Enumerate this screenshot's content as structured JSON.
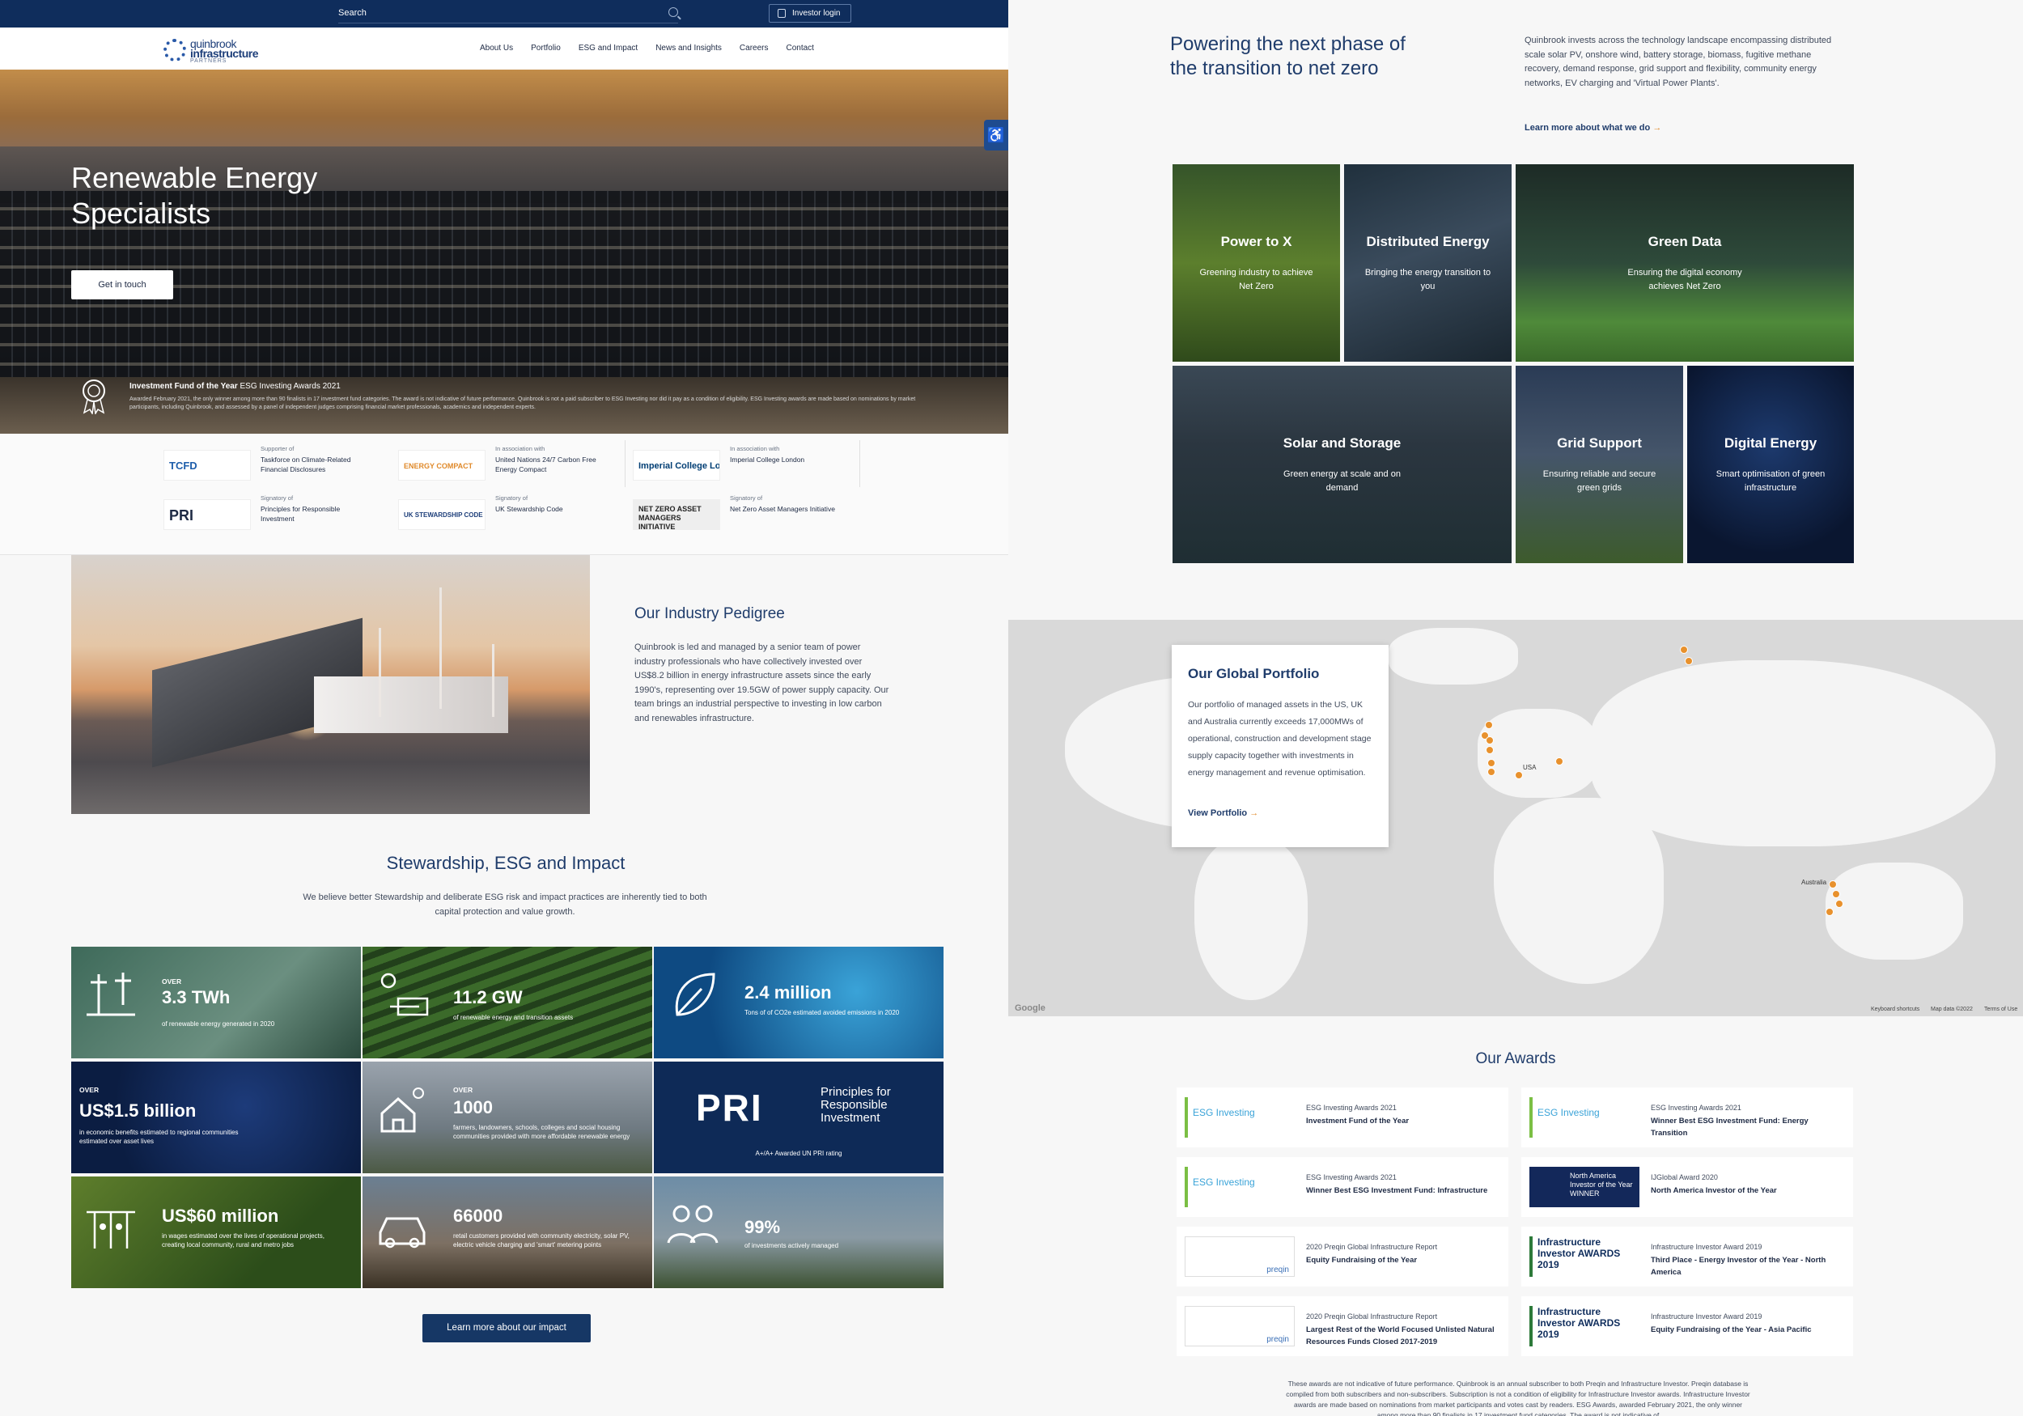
{
  "topbar": {
    "search_label": "Search",
    "investor_login": "Investor login"
  },
  "logo": {
    "line1": "quinbrook",
    "line2": "infrastructure",
    "line3": "PARTNERS"
  },
  "nav": [
    "About Us",
    "Portfolio",
    "ESG and Impact",
    "News and Insights",
    "Careers",
    "Contact"
  ],
  "hero": {
    "title": "Renewable Energy Specialists",
    "cta": "Get in touch",
    "award_title_bold": "Investment Fund of the Year",
    "award_title_rest": " ESG Investing Awards 2021",
    "award_desc": "Awarded February 2021, the only winner among more than 90 finalists in 17 investment fund categories. The award is not indicative of future performance. Quinbrook is not a paid subscriber to ESG Investing nor did it pay as a condition of eligibility. ESG Investing awards are made based on nominations by market participants, including Quinbrook, and assessed by a panel of independent judges comprising financial market professionals, academics and independent experts."
  },
  "supporters": [
    {
      "logo": "TCFD",
      "s1": "Supporter of",
      "s2": "Taskforce on Climate-Related Financial Disclosures"
    },
    {
      "logo": "ENERGY COMPACT",
      "s1": "In association with",
      "s2": "United Nations 24/7 Carbon Free Energy Compact"
    },
    {
      "logo": "Imperial College London",
      "s1": "In association with",
      "s2": "Imperial College London"
    },
    {
      "logo": "PRI",
      "s1": "Signatory of",
      "s2": "Principles for Responsible Investment"
    },
    {
      "logo": "UK STEWARDSHIP CODE 2021",
      "s1": "Signatory of",
      "s2": "UK Stewardship Code"
    },
    {
      "logo": "NET ZERO ASSET MANAGERS INITIATIVE",
      "s1": "Signatory of",
      "s2": "Net Zero Asset Managers Initiative"
    }
  ],
  "pedigree": {
    "title": "Our Industry Pedigree",
    "text": "Quinbrook is led and managed by a senior team of power industry professionals who have collectively invested over US$8.2 billion in energy infrastructure assets since the early 1990's, representing over 19.5GW of power supply capacity. Our team brings an industrial perspective to investing in low carbon and renewables infrastructure."
  },
  "stewardship": {
    "title": "Stewardship, ESG and Impact",
    "text": "We believe better Stewardship and deliberate ESG risk and impact practices are inherently tied to both capital protection and value growth.",
    "tiles": [
      {
        "over": "OVER",
        "big": "3.3 TWh",
        "sub": "of renewable energy generated in 2020"
      },
      {
        "over": "",
        "big": "11.2 GW",
        "sub": "of renewable energy and transition assets"
      },
      {
        "over": "",
        "big": "2.4 million",
        "sub": "Tons of of CO2e estimated avoided emissions in 2020"
      },
      {
        "over": "OVER",
        "big": "US$1.5 billion",
        "sub": "in economic benefits estimated to regional communities estimated over asset lives"
      },
      {
        "over": "OVER",
        "big": "1000",
        "sub": "farmers, landowners, schools, colleges and social housing communities provided with more affordable renewable energy"
      },
      {
        "over": "",
        "big": "PRI",
        "sub": "A+/A+ Awarded UN PRI rating"
      },
      {
        "over": "",
        "big": "US$60 million",
        "sub": "in wages estimated over the lives of operational projects, creating local community, rural and metro jobs"
      },
      {
        "over": "",
        "big": "66000",
        "sub": "retail customers provided with community electricity, solar PV, electric vehicle charging and 'smart' metering points"
      },
      {
        "over": "",
        "big": "99%",
        "sub": "of investments actively managed"
      }
    ],
    "pri_text": "Principles for Responsible Investment",
    "cta": "Learn more about our impact"
  },
  "powering": {
    "title": "Powering the next phase of the transition to net zero",
    "text": "Quinbrook invests across the technology landscape encompassing distributed scale solar PV, onshore wind, battery storage, biomass, fugitive methane recovery, demand response, grid support and flexibility, community energy networks, EV charging and 'Virtual Power Plants'.",
    "link": "Learn more about what we do",
    "arrow": "→"
  },
  "sectors": [
    {
      "title": "Power to X",
      "sub": "Greening industry to achieve Net Zero"
    },
    {
      "title": "Distributed Energy",
      "sub": "Bringing the energy transition to you"
    },
    {
      "title": "Green Data",
      "sub": "Ensuring the digital economy achieves Net Zero"
    },
    {
      "title": "Solar and Storage",
      "sub": "Green energy at scale and on demand"
    },
    {
      "title": "Grid Support",
      "sub": "Ensuring reliable and secure green grids"
    },
    {
      "title": "Digital Energy",
      "sub": "Smart optimisation of green infrastructure"
    }
  ],
  "portfolio": {
    "title": "Our Global Portfolio",
    "text": "Our portfolio of managed assets in the US, UK and Australia currently exceeds 17,000MWs of operational, construction and development stage supply capacity together with investments in energy management and revenue optimisation.",
    "link": "View Portfolio",
    "arrow": "→",
    "labels": {
      "usa": "USA",
      "australia": "Australia"
    },
    "footer": {
      "google": "Google",
      "shortcuts": "Keyboard shortcuts",
      "mapdata": "Map data ©2022",
      "terms": "Terms of Use"
    }
  },
  "awards": {
    "title": "Our Awards",
    "items": [
      {
        "logo": "ESG Investing",
        "a1": "ESG Investing Awards 2021",
        "a2": "Investment Fund of the Year"
      },
      {
        "logo": "ESG Investing",
        "a1": "ESG Investing Awards 2021",
        "a2": "Winner Best ESG Investment Fund: Energy Transition"
      },
      {
        "logo": "ESG Investing",
        "a1": "ESG Investing Awards 2021",
        "a2": "Winner Best ESG Investment Fund: Infrastructure"
      },
      {
        "logo": "North America Investor of the Year WINNER",
        "a1": "IJGlobal Award 2020",
        "a2": "North America Investor of the Year"
      },
      {
        "logo": "preqin",
        "a1": "2020 Preqin Global Infrastructure Report",
        "a2": "Equity Fundraising of the Year"
      },
      {
        "logo": "Infrastructure Investor AWARDS 2019",
        "a1": "Infrastructure Investor Award 2019",
        "a2": "Third Place - Energy Investor of the Year - North America"
      },
      {
        "logo": "preqin",
        "a1": "2020 Preqin Global Infrastructure Report",
        "a2": "Largest Rest of the World Focused Unlisted Natural Resources Funds Closed 2017-2019"
      },
      {
        "logo": "Infrastructure Investor AWARDS 2019",
        "a1": "Infrastructure Investor Award 2019",
        "a2": "Equity Fundraising of the Year - Asia Pacific"
      }
    ],
    "note": "These awards are not indicative of future performance. Quinbrook is an annual subscriber to both Preqin and Infrastructure Investor. Preqin database is compiled from both subscribers and non-subscribers. Subscription is not a condition of eligibility for Infrastructure Investor awards. Infrastructure Investor awards are made based on nominations from market participants and votes cast by readers. ESG Awards, awarded February 2021, the only winner among more than 90 finalists in 17 investment fund categories. The award is not indicative of"
  }
}
